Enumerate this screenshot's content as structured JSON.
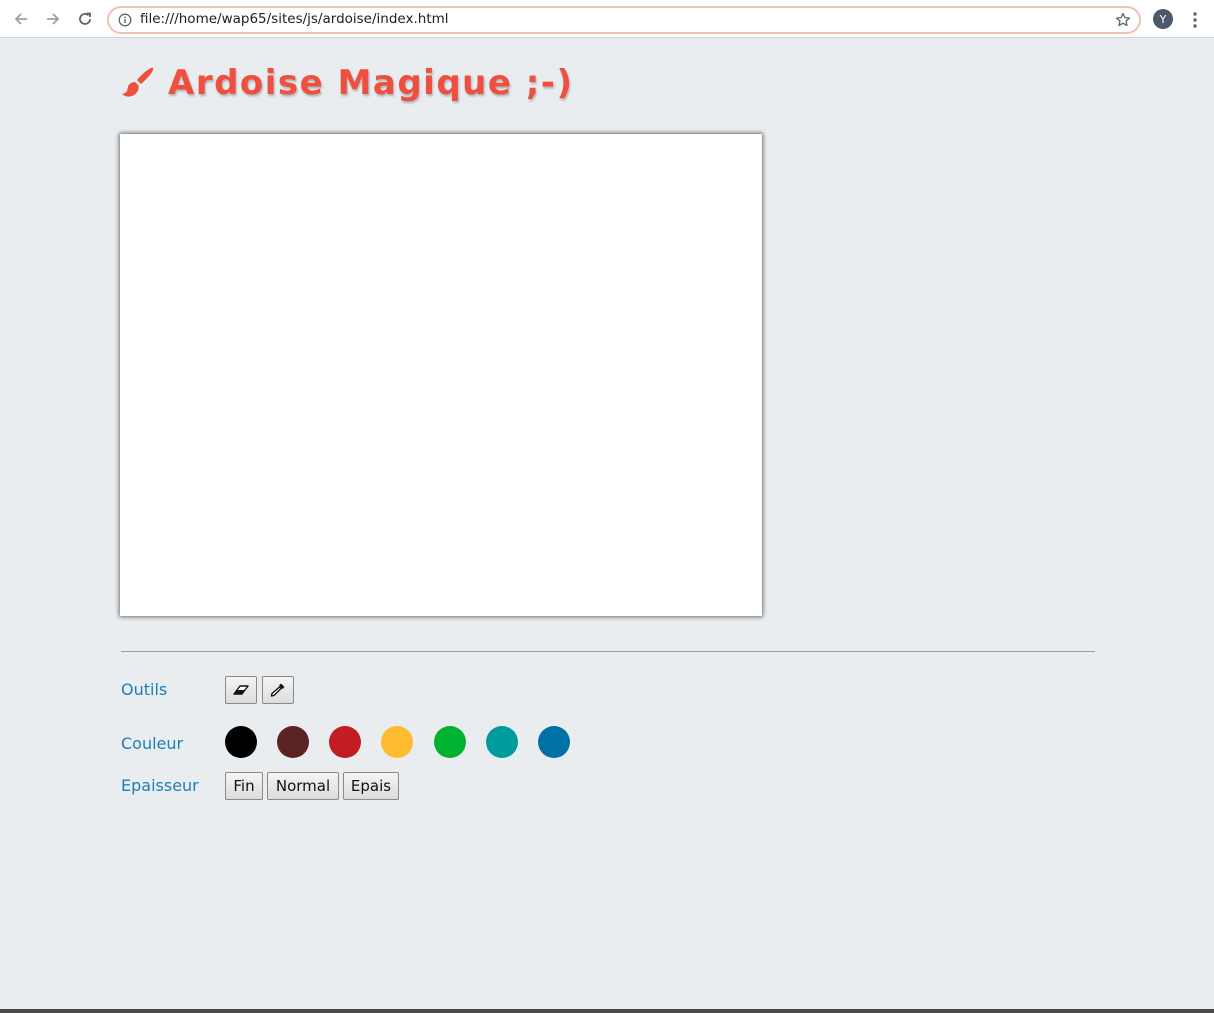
{
  "browser": {
    "url": "file:///home/wap65/sites/js/ardoise/index.html",
    "profile_initial": "Y",
    "icons": {
      "back": "back-arrow-icon",
      "forward": "forward-arrow-icon",
      "reload": "reload-icon",
      "info": "info-icon",
      "bookmark": "star-icon",
      "menu": "kebab-menu-icon"
    }
  },
  "page": {
    "title": "Ardoise Magique ;-)",
    "title_icon": "paint-brush-icon",
    "title_color": "#ef4f3e"
  },
  "controls": {
    "tools_label": "Outils",
    "tools": [
      {
        "name": "eraser",
        "icon": "eraser-icon"
      },
      {
        "name": "eyedropper",
        "icon": "eyedropper-icon"
      }
    ],
    "color_label": "Couleur",
    "colors": [
      "#000000",
      "#5b2323",
      "#c21c24",
      "#fdbb30",
      "#00b230",
      "#009b9c",
      "#0171a3"
    ],
    "thickness_label": "Epaisseur",
    "thickness": [
      "Fin",
      "Normal",
      "Epais"
    ],
    "label_color": "#1c7eb8"
  }
}
